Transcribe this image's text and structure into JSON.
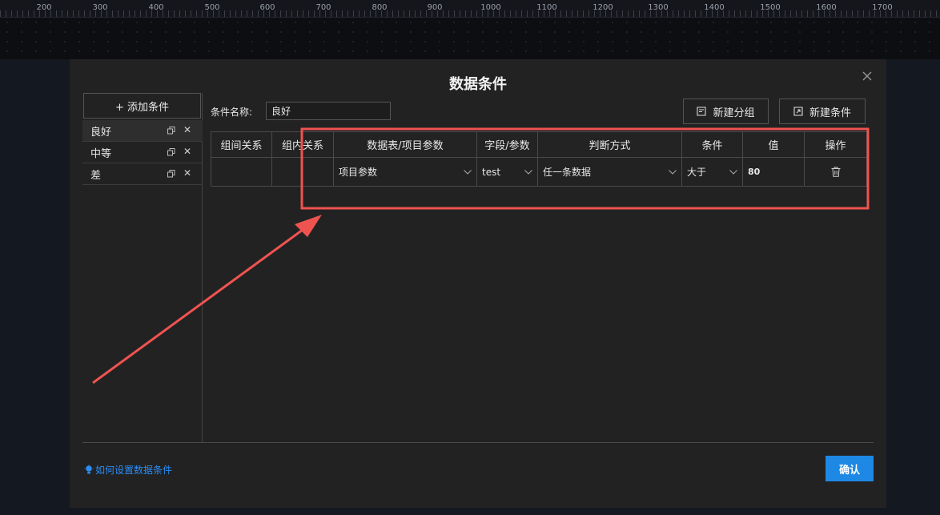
{
  "ruler": {
    "labels": [
      "200",
      "300",
      "400",
      "500",
      "600",
      "700",
      "800",
      "900",
      "1000",
      "1100",
      "1200",
      "1300",
      "1400",
      "1500",
      "1600",
      "1700"
    ]
  },
  "modal": {
    "title": "数据条件",
    "close_icon": "close-icon"
  },
  "left": {
    "add_label": "+ 添加条件",
    "conditions": [
      {
        "label": "良好",
        "active": true
      },
      {
        "label": "中等",
        "active": false
      },
      {
        "label": "差",
        "active": false
      }
    ]
  },
  "form": {
    "name_label": "条件名称:",
    "name_value": "良好",
    "new_group_label": "新建分组",
    "new_condition_label": "新建条件"
  },
  "table": {
    "headers": [
      "组间关系",
      "组内关系",
      "数据表/项目参数",
      "字段/参数",
      "判断方式",
      "条件",
      "值",
      "操作"
    ],
    "rows": [
      {
        "inter_group": "",
        "intra_group": "",
        "source": "项目参数",
        "field": "test",
        "method": "任一条数据",
        "operator": "大于",
        "value": "80",
        "action_icon": "trash-icon"
      }
    ]
  },
  "footer": {
    "help_label": "如何设置数据条件",
    "confirm_label": "确认"
  },
  "colors": {
    "accent": "#1e88e5",
    "link": "#2c8df5",
    "annotation": "#ef5350"
  }
}
